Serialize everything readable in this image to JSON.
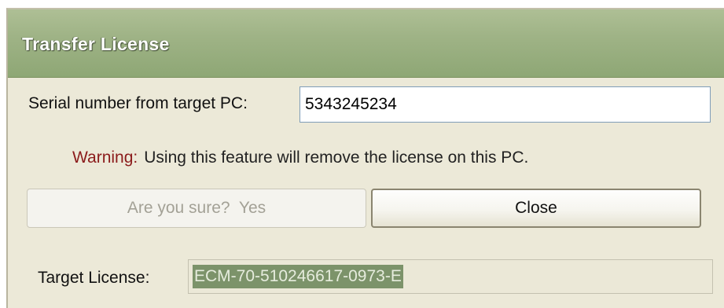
{
  "dialog": {
    "title": "Transfer License"
  },
  "serial": {
    "label": "Serial number from target PC:",
    "value": "5343245234"
  },
  "warning": {
    "label": "Warning:",
    "message": "Using this feature will remove the license on this PC."
  },
  "buttons": {
    "confirm_label": "Are you sure?  Yes",
    "close_label": "Close"
  },
  "target_license": {
    "label": "Target License:",
    "value": "ECM-70-510246617-0973-E"
  },
  "colors": {
    "titlebar": "#9fb386",
    "dialog_bg": "#ece9d8",
    "warning_label": "#8b1b1b",
    "selection_highlight": "#7c936a"
  }
}
